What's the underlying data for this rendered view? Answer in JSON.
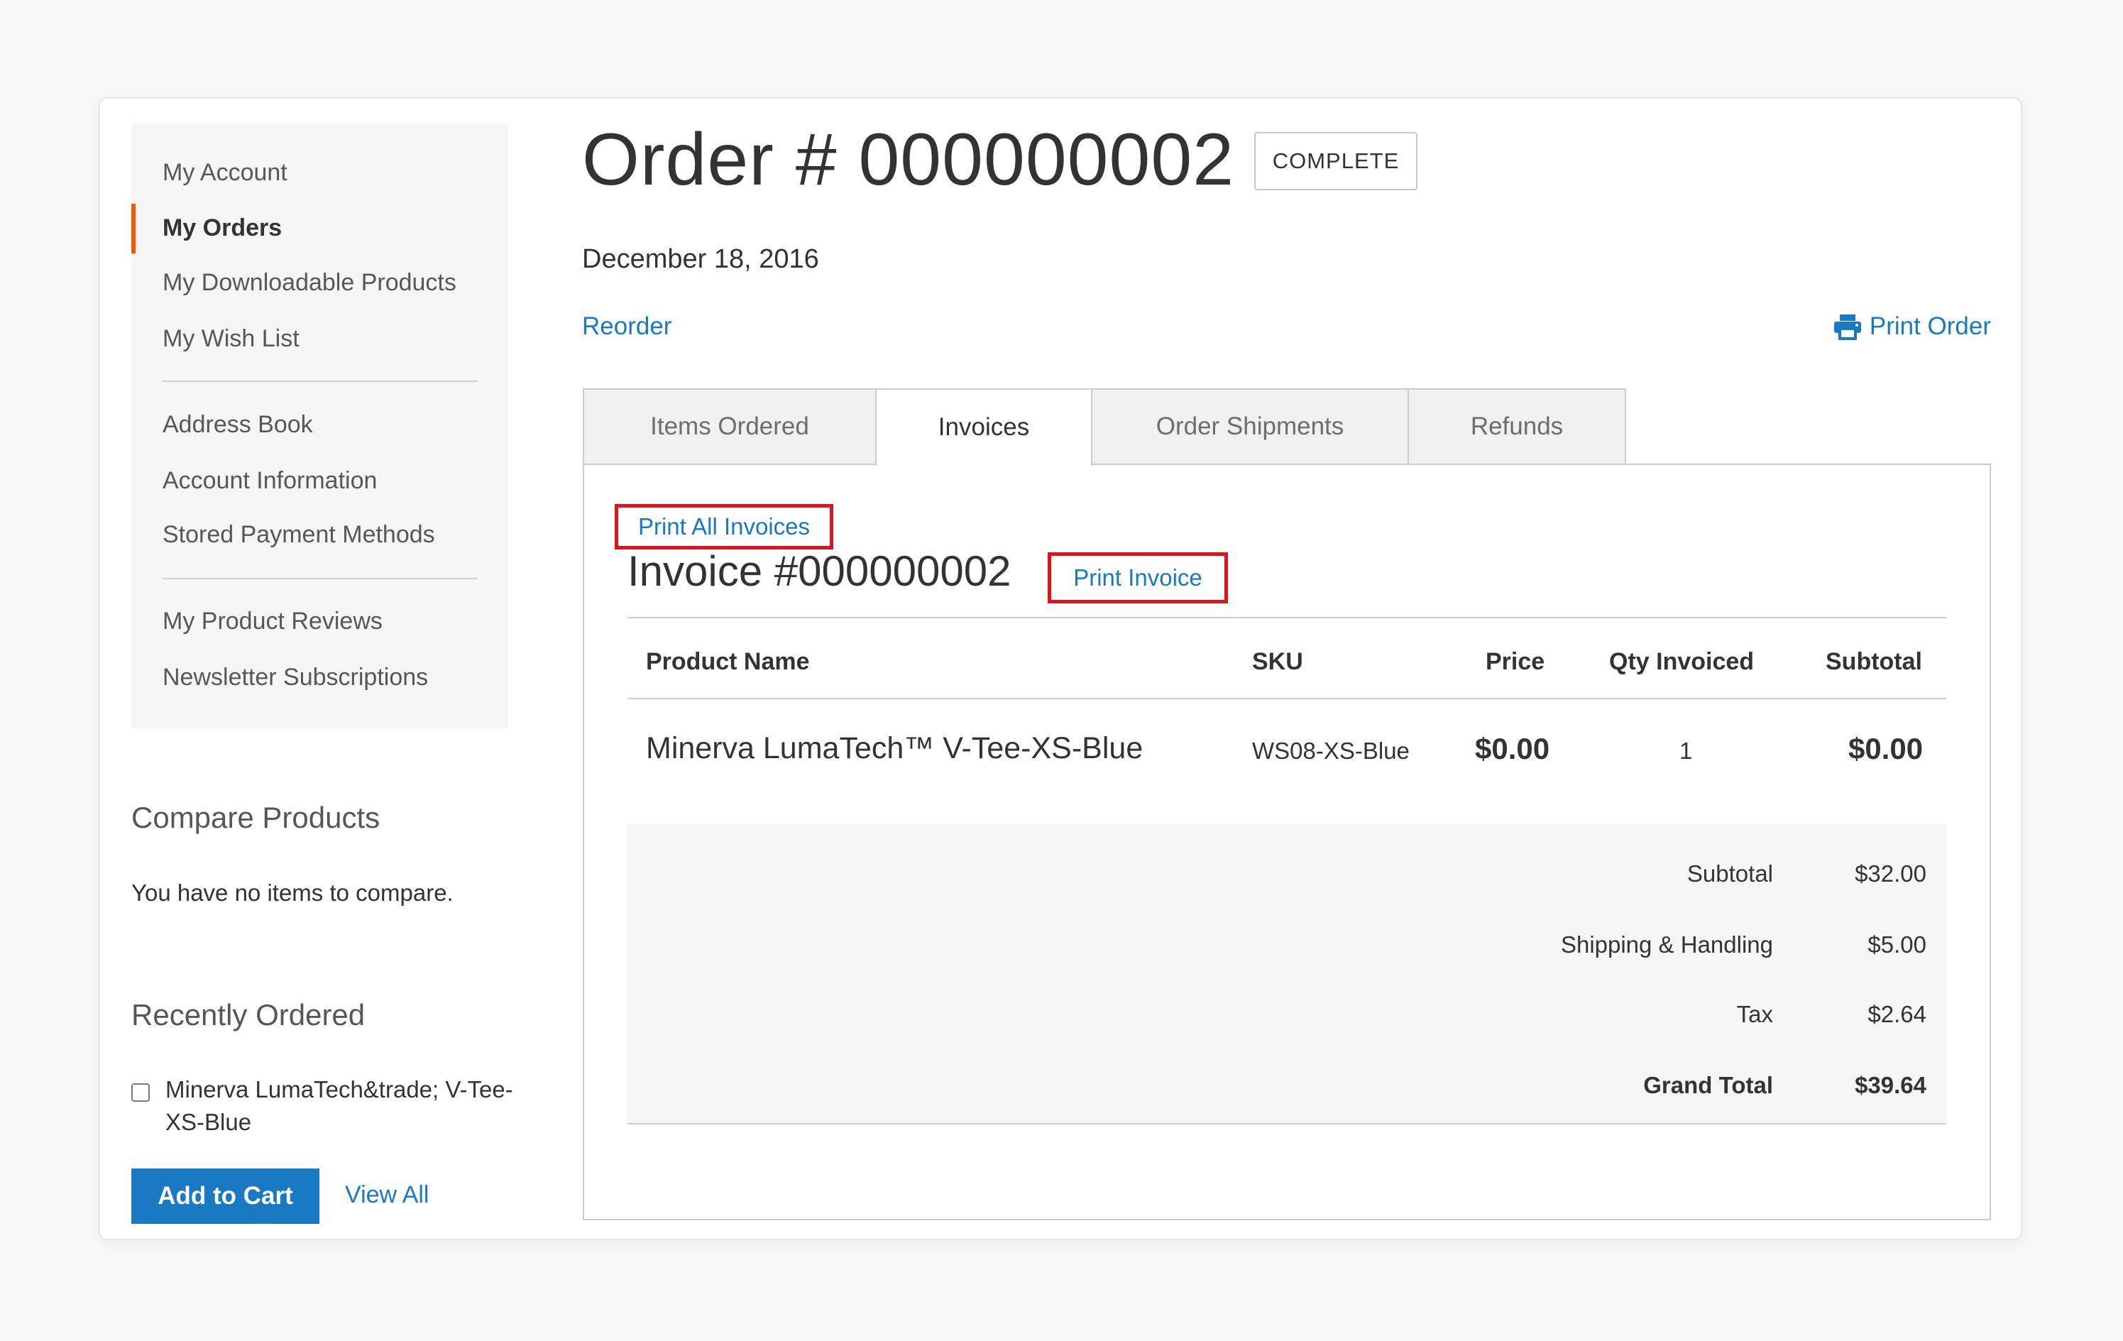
{
  "sidebar": {
    "items": [
      {
        "label": "My Account"
      },
      {
        "label": "My Orders",
        "active": true
      },
      {
        "label": "My Downloadable Products"
      },
      {
        "label": "My Wish List"
      },
      {
        "label": "Address Book"
      },
      {
        "label": "Account Information"
      },
      {
        "label": "Stored Payment Methods"
      },
      {
        "label": "My Product Reviews"
      },
      {
        "label": "Newsletter Subscriptions"
      }
    ],
    "active_color": "#ff5501"
  },
  "compare": {
    "heading": "Compare Products",
    "empty_text": "You have no items to compare."
  },
  "recent": {
    "heading": "Recently Ordered",
    "item_label": "Minerva LumaTech&trade; V-Tee-XS-Blue",
    "add_to_cart_label": "Add to Cart",
    "view_all_label": "View All"
  },
  "order": {
    "title": "Order # 000000002",
    "status": "COMPLETE",
    "date": "December 18, 2016",
    "reorder_label": "Reorder",
    "print_order_label": "Print Order"
  },
  "tabs": [
    {
      "label": "Items Ordered"
    },
    {
      "label": "Invoices",
      "active": true
    },
    {
      "label": "Order Shipments"
    },
    {
      "label": "Refunds"
    }
  ],
  "invoice": {
    "print_all_label": "Print All Invoices",
    "title": "Invoice #000000002",
    "print_invoice_label": "Print Invoice",
    "columns": [
      "Product Name",
      "SKU",
      "Price",
      "Qty Invoiced",
      "Subtotal"
    ],
    "rows": [
      {
        "product": "Minerva LumaTech™ V-Tee-XS-Blue",
        "sku": "WS08-XS-Blue",
        "price": "$0.00",
        "qty": "1",
        "subtotal": "$0.00"
      }
    ],
    "totals": [
      {
        "label": "Subtotal",
        "value": "$32.00"
      },
      {
        "label": "Shipping & Handling",
        "value": "$5.00"
      },
      {
        "label": "Tax",
        "value": "$2.64"
      },
      {
        "label": "Grand Total",
        "value": "$39.64",
        "grand": true
      }
    ]
  },
  "colors": {
    "link": "#1979c3",
    "button": "#1979c3",
    "highlight_box": "#e0121c"
  }
}
